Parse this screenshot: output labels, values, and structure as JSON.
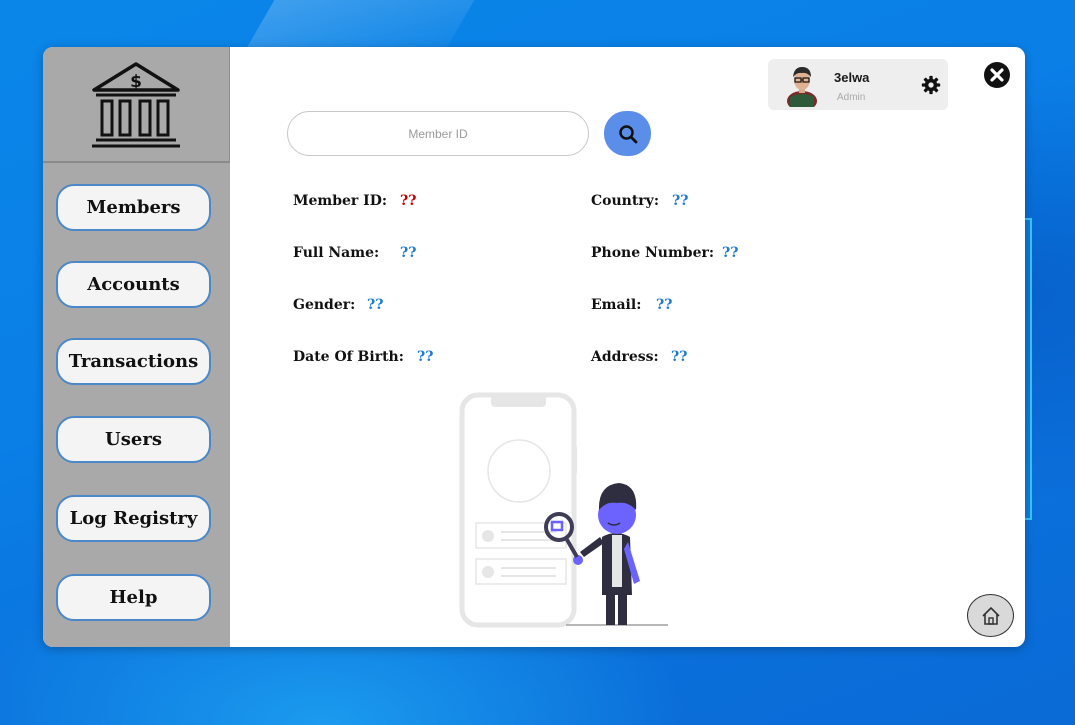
{
  "theme": {
    "accent": "#5b8ee8",
    "sidebar_bg": "#a9a9a9",
    "value_red": "#c00000",
    "value_blue": "#1a7ad4"
  },
  "sidebar": {
    "logo_icon": "bank-icon",
    "items": [
      {
        "label": "Members"
      },
      {
        "label": "Accounts"
      },
      {
        "label": "Transactions"
      },
      {
        "label": "Users"
      },
      {
        "label": "Log Registry"
      },
      {
        "label": "Help"
      }
    ]
  },
  "search": {
    "placeholder": "Member ID",
    "value": "",
    "button_icon": "search-icon"
  },
  "user": {
    "name": "3elwa",
    "role": "Admin",
    "settings_icon": "gear-icon"
  },
  "window": {
    "close_icon": "close-icon",
    "home_icon": "home-icon"
  },
  "details": {
    "member_id": {
      "label": "Member ID:",
      "value": "??"
    },
    "full_name": {
      "label": "Full Name:",
      "value": "??"
    },
    "gender": {
      "label": "Gender:",
      "value": "??"
    },
    "dob": {
      "label": "Date Of Birth:",
      "value": "??"
    },
    "country": {
      "label": "Country:",
      "value": "??"
    },
    "phone": {
      "label": "Phone Number:",
      "value": "??"
    },
    "email": {
      "label": "Email:",
      "value": "??"
    },
    "address": {
      "label": "Address:",
      "value": "??"
    }
  }
}
